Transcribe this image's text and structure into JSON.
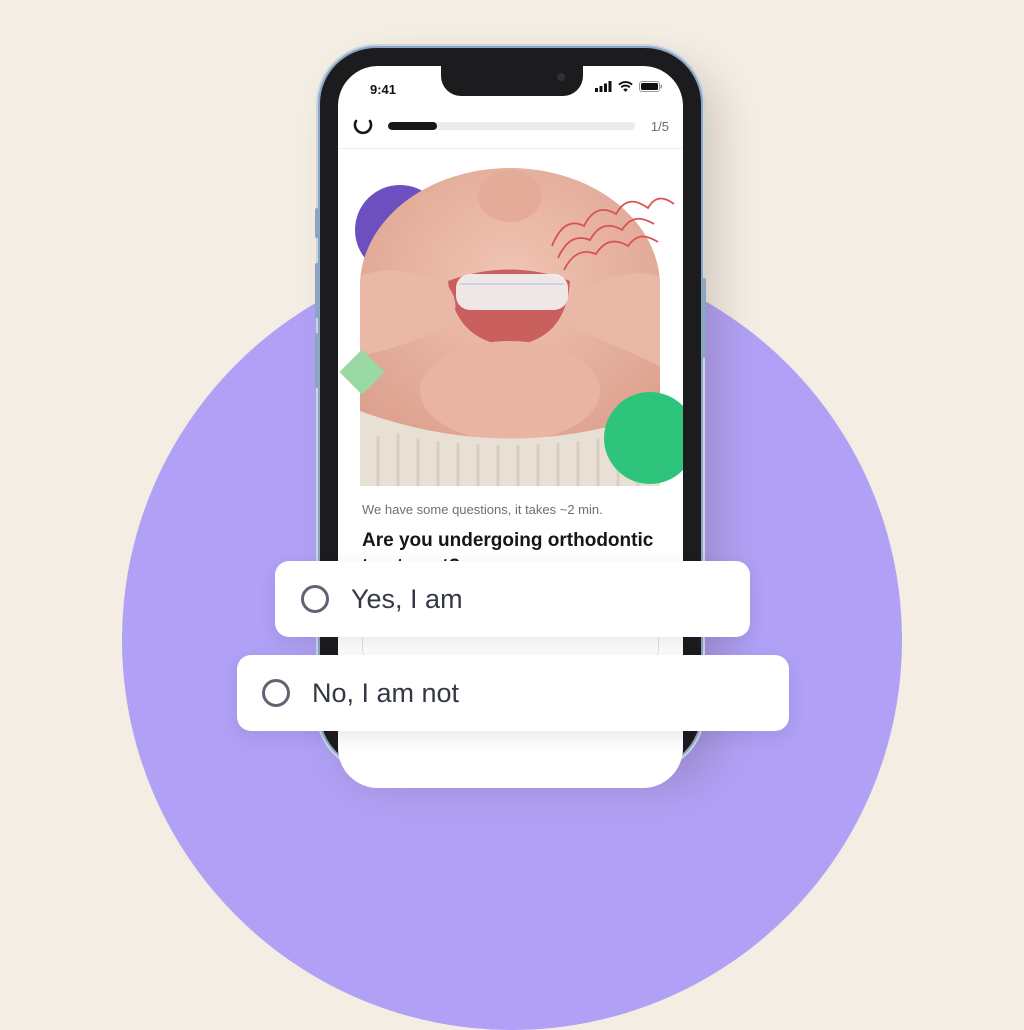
{
  "status_bar": {
    "time": "9:41"
  },
  "progress": {
    "step_label": "1/5",
    "fraction": 0.2
  },
  "intro_text": "We have some questions, it takes ~2 min.",
  "question_text": "Are you undergoing orthodontic treatment?",
  "answers": [
    {
      "label": "Yes, I am"
    },
    {
      "label": "No, I am not"
    }
  ],
  "colors": {
    "background": "#f4ede4",
    "accent_lavender": "#b1a1f6",
    "purple_shape": "#6e4fbf",
    "yellow_shape": "#f7c11a",
    "green_shape": "#2ec47c",
    "mint_shape": "#9ad9a4",
    "squiggle": "#d9534f"
  },
  "icons": [
    "back-arc-icon",
    "signal-icon",
    "wifi-icon",
    "battery-icon",
    "radio-icon"
  ]
}
